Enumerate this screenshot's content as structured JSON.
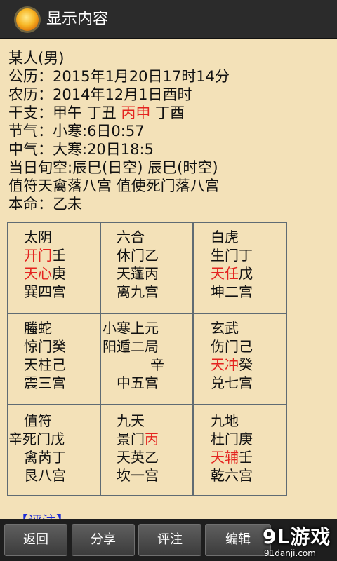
{
  "header": {
    "title": "显示内容"
  },
  "info": {
    "person": "某人(男)",
    "gongli": "公历：2015年1月20日17时14分",
    "nongli": "农历：2014年12月1日酉时",
    "ganzhi_prefix": "干支：甲午 丁丑 ",
    "ganzhi_highlight": "丙申",
    "ganzhi_suffix": " 丁酉",
    "jieqi": "节气：小寒:6日0:57",
    "zhongqi": "中气：大寒:20日18:5",
    "xunkong": "当日旬空:辰巳(日空) 辰巳(时空)",
    "zhifu": "值符天禽落八宫 值使死门落八宫",
    "benming": "本命：乙未"
  },
  "palaces": [
    {
      "line1": "太阴",
      "line2": "开门壬",
      "line3": "天心庚",
      "line4": "巽四宫"
    },
    {
      "line1": "六合",
      "line2": "休门乙",
      "line3": "天蓬丙",
      "line4": "离九宫"
    },
    {
      "line1": "白虎",
      "line2": "生门丁",
      "line3": "天任戊",
      "line4": "坤二宫"
    },
    {
      "line1": "螣蛇",
      "line2": "惊门癸",
      "line3": "天柱己",
      "line4": "震三宫"
    },
    {
      "line1": "小寒上元",
      "line2": "阳遁二局",
      "line3": "辛",
      "line4": "中五宫"
    },
    {
      "line1": "玄武",
      "line2": "伤门己",
      "line3": "天冲癸",
      "line4": "兑七宫"
    },
    {
      "line1": "值符",
      "line2": "辛死门戊",
      "line3": "禽芮丁",
      "line4": "艮八宫"
    },
    {
      "line1": "九天",
      "line2": "景门丙",
      "line3": "天英乙",
      "line4": "坎一宫"
    },
    {
      "line1": "九地",
      "line2": "杜门庚",
      "line3": "天辅壬",
      "line4": "乾六宫"
    }
  ],
  "section": {
    "pingzhu_label": "【评注】"
  },
  "toolbar": {
    "back": "返回",
    "share": "分享",
    "comment": "评注",
    "edit": "编辑"
  },
  "watermark": {
    "logo": "9L游戏",
    "url": "91danji.com"
  },
  "colors": {
    "highlight_red": "#e4231f",
    "highlight_blue": "#1d2bd6",
    "background": "#f3e1b8",
    "titlebar": "#2b2b2b"
  }
}
